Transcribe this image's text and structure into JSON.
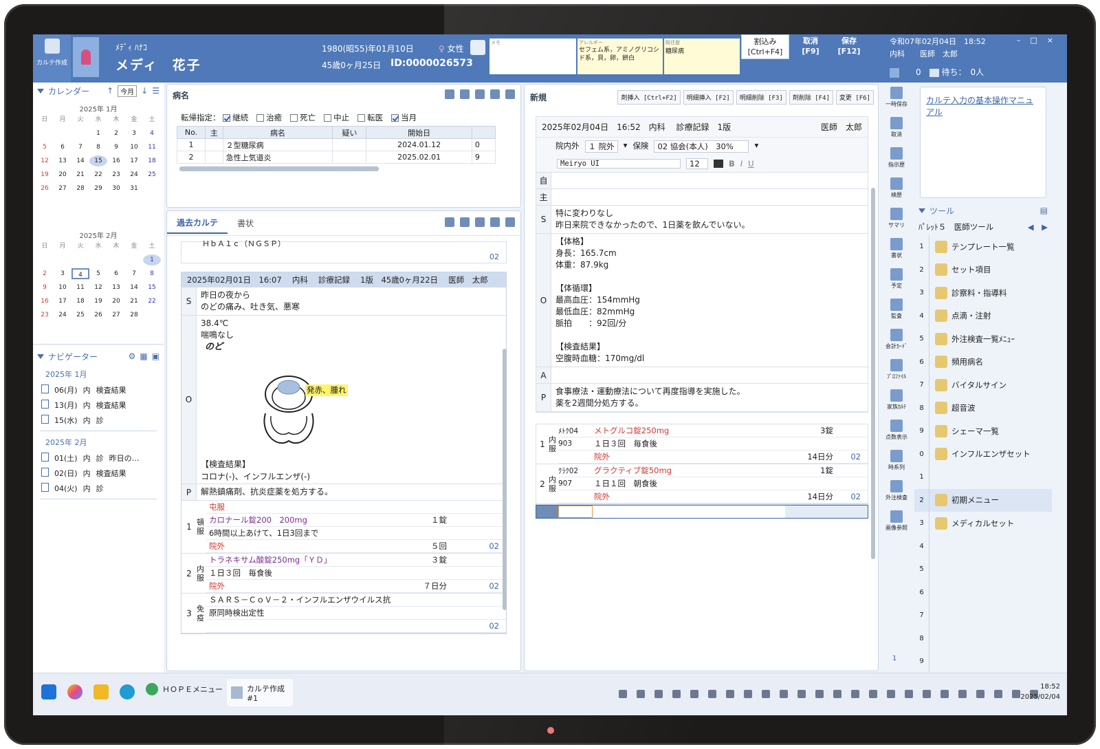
{
  "header": {
    "karte_tab_label": "カルテ作成",
    "patient_kana": "ﾒﾃﾞｨ ﾊﾅｺ",
    "patient_name": "メディ　花子",
    "birth_date": "1980(昭55)年01月10日",
    "age": "45歳0ヶ月25日",
    "patient_id": "ID:0000026573",
    "sex": "女性",
    "memo_label": "メモ",
    "allergy_label": "アレルギー",
    "allergy_text": "セフェム系，アミノグリコシド系，貝，卵，餅白",
    "history_label": "既往歴",
    "history_text": "糖尿病",
    "interrupt_label": "割込み",
    "interrupt_key": "[Ctrl+F4]",
    "cancel_label": "取消",
    "cancel_key": "[F9]",
    "save_label": "保存",
    "save_key": "[F12]",
    "datetime": "令和07年02月04日　18:52",
    "department": "内科",
    "doctor": "医師　太郎",
    "count_zero": "0",
    "waiting": "待ち：　0人"
  },
  "calendar": {
    "title": "カレンダー",
    "today_button": "今月",
    "weekdays": [
      "日",
      "月",
      "火",
      "水",
      "木",
      "金",
      "土"
    ],
    "january_title": "2025年 1月",
    "february_title": "2025年 2月",
    "january_days": [
      "",
      "",
      "",
      "1",
      "2",
      "3",
      "4",
      "5",
      "6",
      "7",
      "8",
      "9",
      "10",
      "11",
      "12",
      "13",
      "14",
      "15",
      "16",
      "17",
      "18",
      "19",
      "20",
      "21",
      "22",
      "23",
      "24",
      "25",
      "26",
      "27",
      "28",
      "29",
      "30",
      "31",
      "",
      ""
    ],
    "february_days": [
      "",
      "",
      "",
      "",
      "",
      "",
      "1",
      "2",
      "3",
      "4",
      "5",
      "6",
      "7",
      "8",
      "9",
      "10",
      "11",
      "12",
      "13",
      "14",
      "15",
      "16",
      "17",
      "18",
      "19",
      "20",
      "21",
      "22",
      "23",
      "24",
      "25",
      "26",
      "27",
      "28",
      ""
    ]
  },
  "navigator": {
    "title": "ナビゲーター",
    "groups": [
      {
        "label": "2025年 1月",
        "rows": [
          {
            "date": "06(月)",
            "dept": "内",
            "type": "検査結果",
            "note": ""
          },
          {
            "date": "13(月)",
            "dept": "内",
            "type": "検査結果",
            "note": ""
          },
          {
            "date": "15(水)",
            "dept": "内",
            "type": "診",
            "note": ""
          }
        ]
      },
      {
        "label": "2025年 2月",
        "rows": [
          {
            "date": "01(土)",
            "dept": "内",
            "type": "診",
            "note": "昨日の…"
          },
          {
            "date": "02(日)",
            "dept": "内",
            "type": "検査結果",
            "note": ""
          },
          {
            "date": "04(火)",
            "dept": "内",
            "type": "診",
            "note": ""
          }
        ]
      }
    ]
  },
  "byomei": {
    "title": "病名",
    "outcome_label": "転帰指定：",
    "filters": [
      {
        "label": "継続",
        "checked": true
      },
      {
        "label": "治癒",
        "checked": false
      },
      {
        "label": "死亡",
        "checked": false
      },
      {
        "label": "中止",
        "checked": false
      },
      {
        "label": "転医",
        "checked": false
      },
      {
        "label": "当月",
        "checked": true
      }
    ],
    "columns": [
      "No.",
      "主",
      "病名",
      "疑い",
      "開始日",
      ""
    ],
    "rows": [
      {
        "no": "1",
        "main": "",
        "name": "２型糖尿病",
        "doubt": "",
        "start": "2024.01.12",
        "extra": "0"
      },
      {
        "no": "2",
        "main": "",
        "name": "急性上気道炎",
        "doubt": "",
        "start": "2025.02.01",
        "extra": "9"
      }
    ]
  },
  "past": {
    "tab_active": "過去カルテ",
    "tab_other": "書状",
    "prev_entry_text": "ＨｂＡ１ｃ（ＮＧＳＰ）",
    "prev_entry_code": "02",
    "entry_header": "2025年02月01日　16:07　 内科　 診療記録　 1版　45歳0ヶ月22日　 医師　太郎",
    "s_label": "S",
    "s_text": [
      "昨日の夜から",
      "のどの痛み、吐き気、悪寒"
    ],
    "o_label": "O",
    "o_text": [
      "38.4℃",
      "喘鳴なし"
    ],
    "o_bold": "のど",
    "throat_note": "発赤、腫れ",
    "lab_title": "【検査結果】",
    "lab_text": "コロナ(-)、インフルエンザ(-)",
    "p_label": "P",
    "p_text": "解熱鎮痛剤、抗炎症薬を処方する。",
    "rx": [
      {
        "no": "1",
        "kind": "頓服",
        "lines": [
          {
            "c1": "屯服",
            "c2": "",
            "cls": "red"
          },
          {
            "c1": "カロナール錠200　200mg",
            "c2": "１錠",
            "cls": "purple"
          },
          {
            "c1": "6時間以上あけて、1日3回まで",
            "c2": "",
            "cls": ""
          },
          {
            "c1": "院外",
            "c2": "５回",
            "code": "02",
            "cls": "red"
          }
        ]
      },
      {
        "no": "2",
        "kind": "内服",
        "lines": [
          {
            "c1": "トラネキサム酸錠250mg「ＹＤ」",
            "c2": "３錠",
            "cls": "purple"
          },
          {
            "c1": "１日３回　毎食後",
            "c2": "",
            "cls": ""
          },
          {
            "c1": "院外",
            "c2": "７日分",
            "code": "02",
            "cls": "red"
          }
        ]
      },
      {
        "no": "3",
        "kind": "免疫",
        "lines": [
          {
            "c1": "ＳＡＲＳ－ＣｏＶ－２・インフルエンザウイルス抗",
            "c2": "",
            "cls": ""
          },
          {
            "c1": "原同時検出定性",
            "c2": "",
            "cls": ""
          },
          {
            "c1": "",
            "c2": "",
            "code": "02",
            "cls": ""
          }
        ]
      }
    ]
  },
  "new": {
    "title": "新規",
    "buttons": [
      "剤挿入 [Ctrl+F2]",
      "明細挿入 [F2]",
      "明細削除 [F3]",
      "剤削除 [F4]",
      "変更 [F6]"
    ],
    "entry_header": "2025年02月04日　16:52　内科　 診療記録　1版",
    "entry_doctor": "医師　太郎",
    "inout": "院内外",
    "inout_val": "１ 院外",
    "insurance": "保険",
    "insurance_val": "02 協会(本人)　30%",
    "font": "Meiryo UI",
    "font_size": "12",
    "row_labels": [
      "自",
      "主",
      "S",
      "O",
      "A",
      "P"
    ],
    "s_text": [
      "特に変わりなし",
      "昨日来院できなかったので、1日薬を飲んでいない。"
    ],
    "o_text": [
      "【体格】",
      "身長：165.7cm",
      "体重：87.9kg",
      "",
      "【体循環】",
      "最高血圧：154mmHg",
      "最低血圧：82mmHg",
      "脈拍　　：92回/分",
      "",
      "【検査結果】",
      "空腹時血糖：170mg/dl"
    ],
    "p_text": [
      "食事療法・運動療法について再度指導を実施した。",
      "薬を2週間分処方する。"
    ],
    "rx": [
      {
        "no": "1",
        "kind": "内服",
        "code1": "ﾒﾄｸ04",
        "drug": "メトグルコ錠250mg",
        "qty": "3錠",
        "code2": "903",
        "usage": "１日３回　毎食後",
        "out": "院外",
        "days": "14日分",
        "ins": "02"
      },
      {
        "no": "2",
        "kind": "内服",
        "code1": "ｸﾗｸ02",
        "drug": "グラクティブ錠50mg",
        "qty": "1錠",
        "code2": "907",
        "usage": "１日１回　朝食後",
        "out": "院外",
        "days": "14日分",
        "ins": "02"
      }
    ]
  },
  "vtoolbar": [
    "一時保存",
    "取消",
    "指示歴",
    "検歴",
    "サマリ",
    "書状",
    "予定",
    "監査",
    "会計ｶｰﾄﾞ",
    "ﾌﾟﾛﾌｧｲﾙ",
    "家族ｶﾙﾃ",
    "点数表示",
    "時系列",
    "外注検査",
    "画像参照"
  ],
  "vtoolbar_page": "1",
  "manual_link": "カルテ入力の基本操作マニュアル",
  "tools": {
    "title": "ツール",
    "palette": "ﾊﾟﾚｯﾄ５　医師ツール",
    "items": [
      {
        "n": "1",
        "label": "テンプレート一覧"
      },
      {
        "n": "2",
        "label": "セット項目"
      },
      {
        "n": "3",
        "label": "診察料・指導料"
      },
      {
        "n": "4",
        "label": "点滴・注射"
      },
      {
        "n": "5",
        "label": "外注検査一覧ﾒﾆｭｰ"
      },
      {
        "n": "6",
        "label": "頻用病名"
      },
      {
        "n": "7",
        "label": "バイタルサイン"
      },
      {
        "n": "8",
        "label": "超音波"
      },
      {
        "n": "9",
        "label": "シェーマ一覧"
      },
      {
        "n": "0",
        "label": "インフルエンザセット"
      },
      {
        "n": "1",
        "label": ""
      },
      {
        "n": "2",
        "label": "初期メニュー"
      },
      {
        "n": "3",
        "label": "メディカルセット"
      },
      {
        "n": "4",
        "label": ""
      },
      {
        "n": "5",
        "label": ""
      },
      {
        "n": "6",
        "label": ""
      },
      {
        "n": "7",
        "label": ""
      },
      {
        "n": "8",
        "label": ""
      },
      {
        "n": "9",
        "label": ""
      }
    ]
  },
  "taskbar": {
    "app1": "ＨＯＰＥメニュー",
    "app2": "カルテ作成#1",
    "time": "18:52",
    "date": "2025/02/04"
  }
}
